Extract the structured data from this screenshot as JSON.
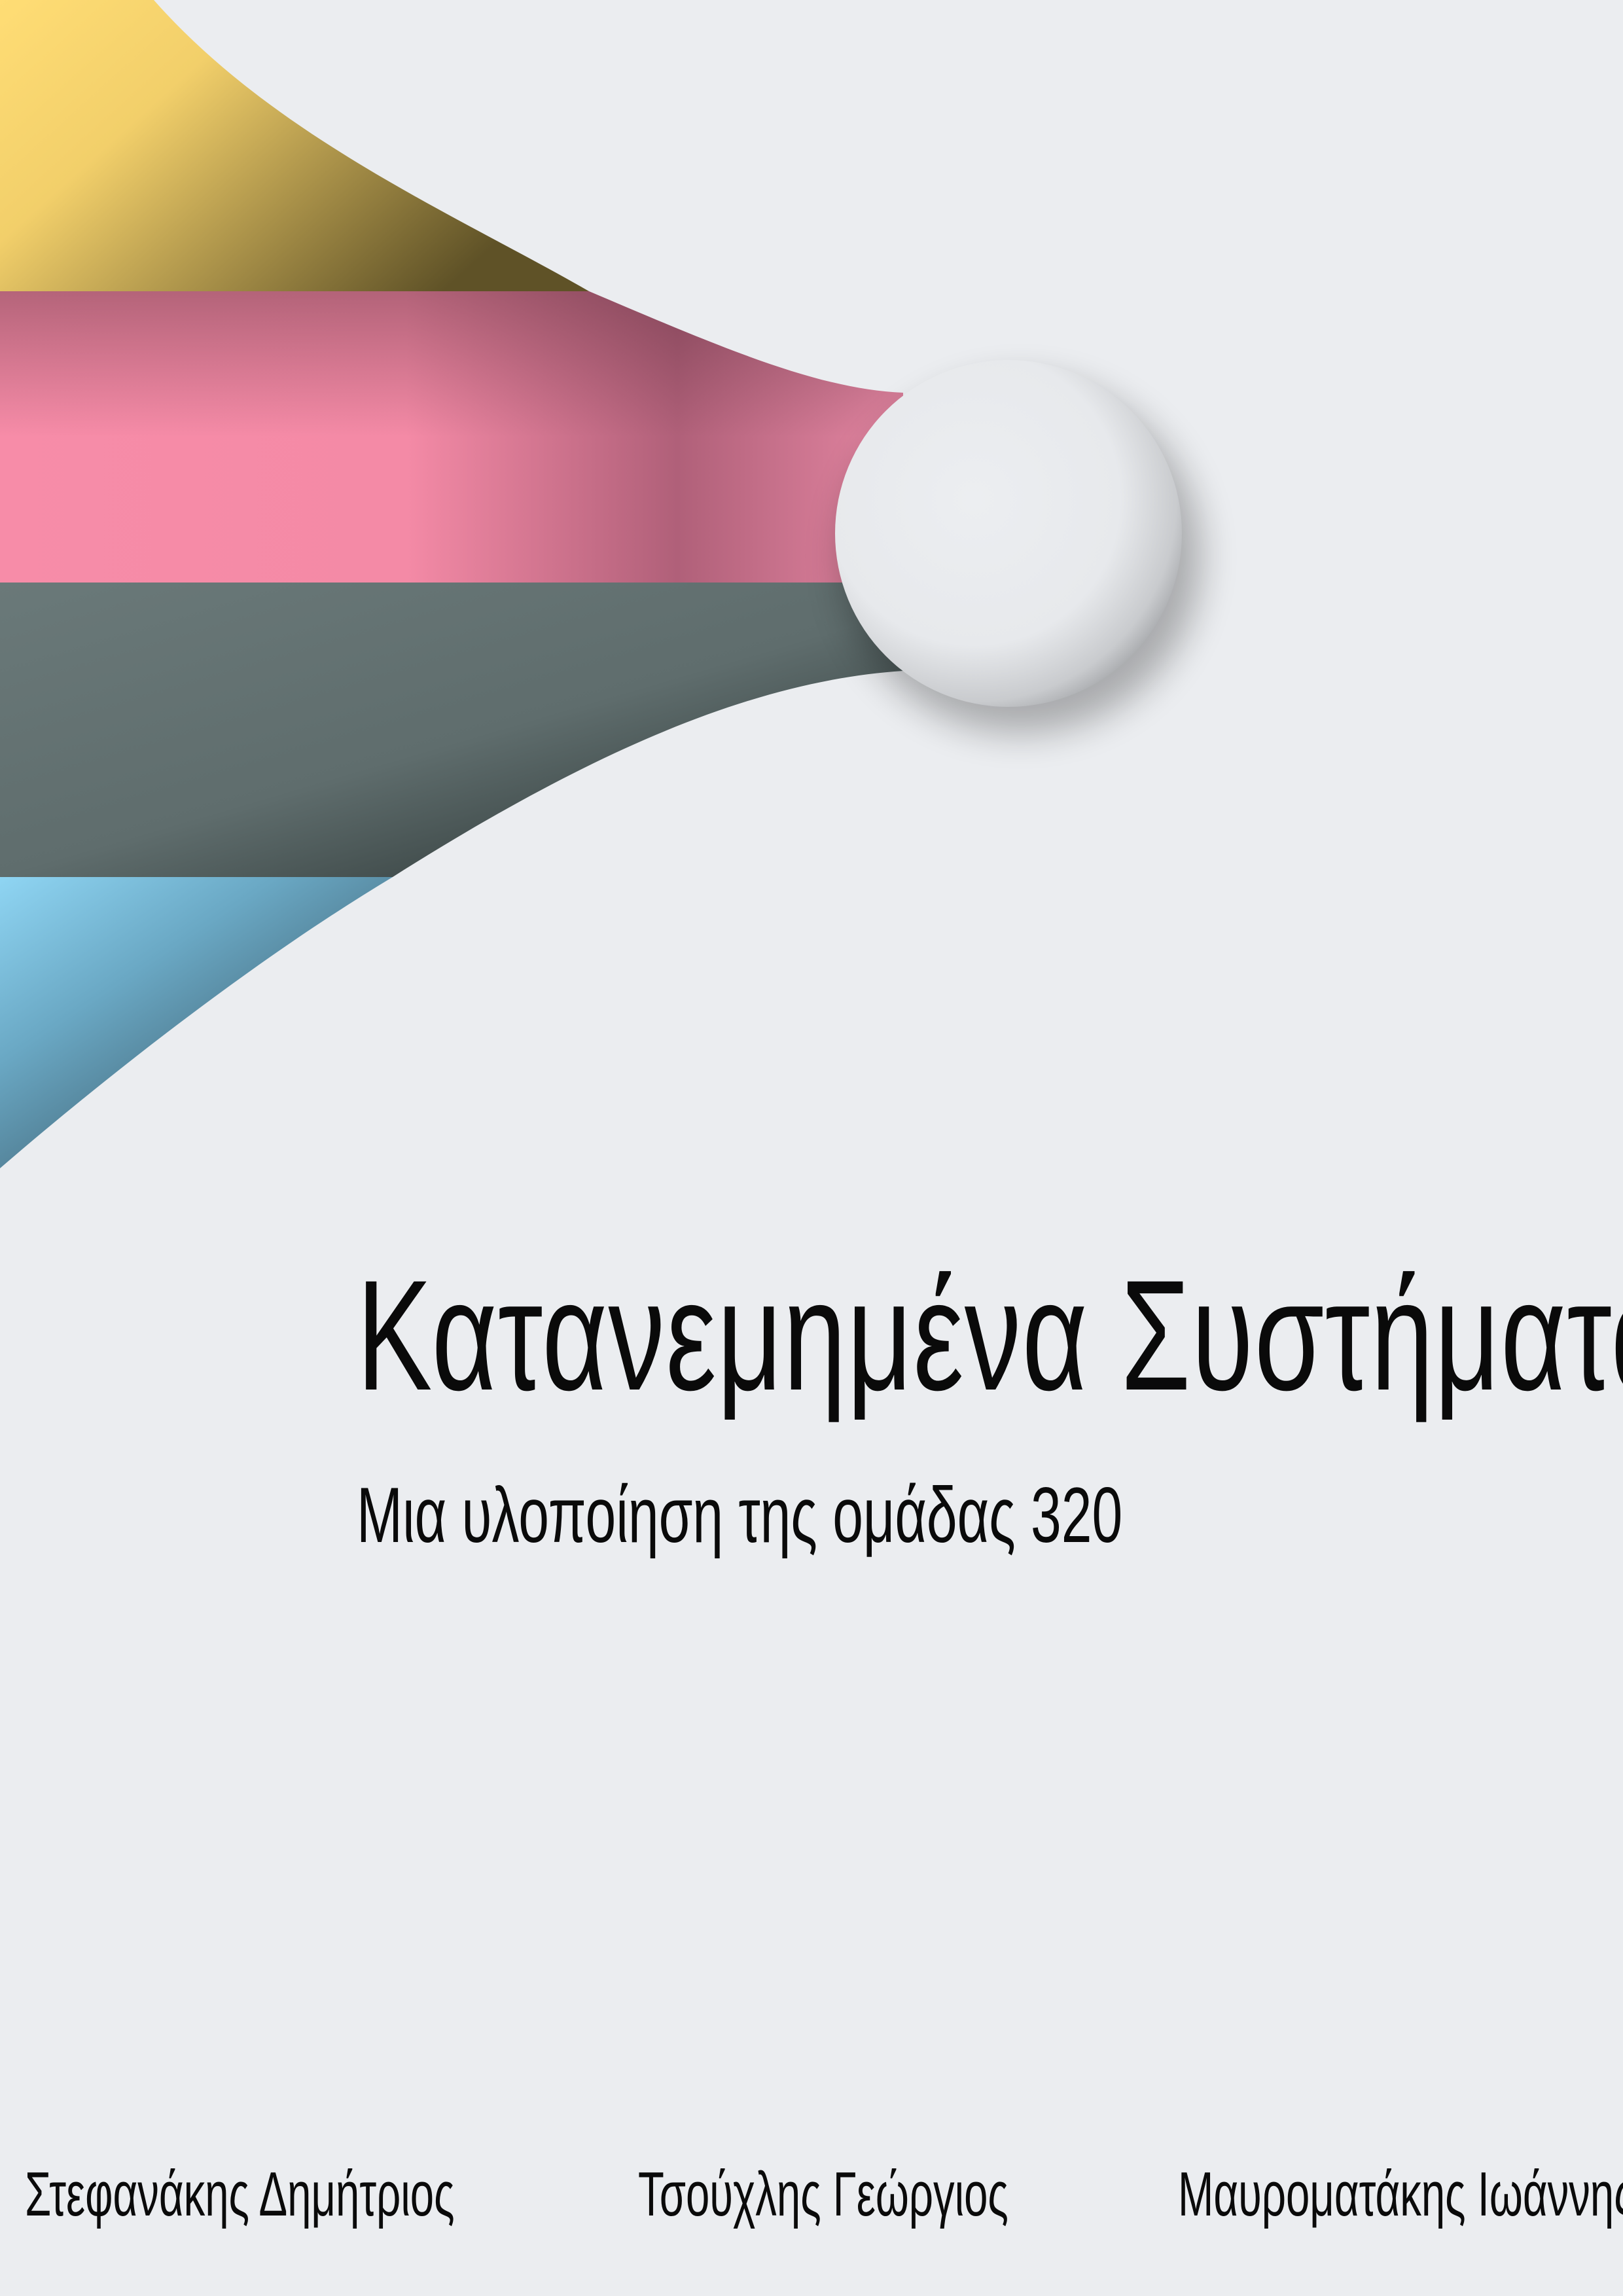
{
  "document": {
    "title": "Κατανεμημένα Συστήματα",
    "subtitle": "Μια υλοποίηση της ομάδας 320"
  },
  "authors": [
    "Στεφανάκης Δημήτριος",
    "Τσούχλης Γεώργιος",
    "Μαυροματάκης Ιωάννης"
  ],
  "colors": {
    "background": "#ebedf0",
    "band_yellow": "#ffdc73",
    "band_pink": "#f78ca8",
    "band_gray": "#697878",
    "band_blue": "#8fd3f0",
    "sphere": "#e9ebee"
  }
}
